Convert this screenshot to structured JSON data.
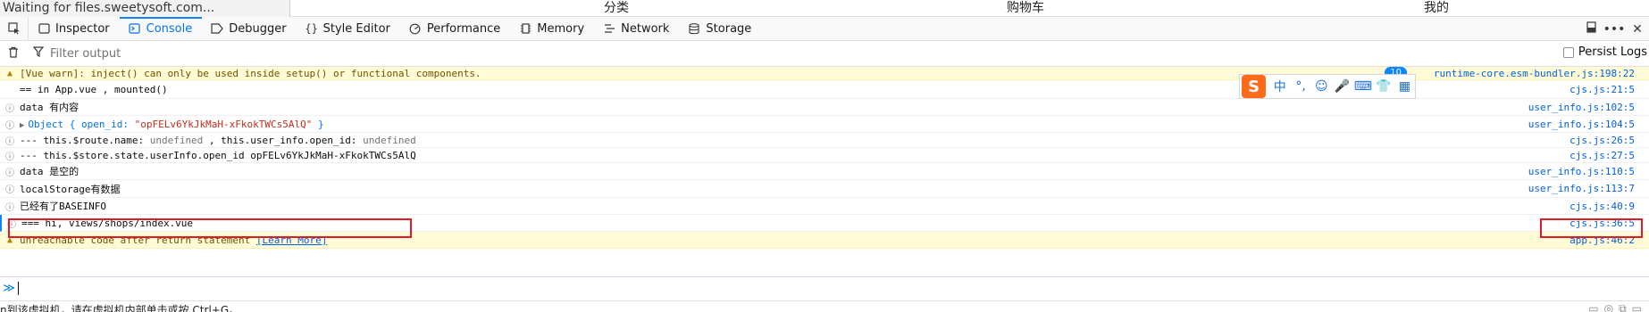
{
  "topbar": {
    "loading_text": "Waiting for files.sweetysoft.com...",
    "app_tabs": [
      "分类",
      "购物车",
      "我的"
    ]
  },
  "devtools": {
    "tabs": [
      {
        "label": "Inspector",
        "icon": "inspector-icon"
      },
      {
        "label": "Console",
        "icon": "console-icon",
        "active": true
      },
      {
        "label": "Debugger",
        "icon": "debugger-icon"
      },
      {
        "label": "Style Editor",
        "icon": "style-editor-icon"
      },
      {
        "label": "Performance",
        "icon": "performance-icon"
      },
      {
        "label": "Memory",
        "icon": "memory-icon"
      },
      {
        "label": "Network",
        "icon": "network-icon"
      },
      {
        "label": "Storage",
        "icon": "storage-icon"
      }
    ],
    "right_icons": [
      "dock-icon",
      "more-icon",
      "close-icon"
    ]
  },
  "filter": {
    "placeholder": "Filter output",
    "persist_label": "Persist Logs"
  },
  "console": {
    "messages": [
      {
        "level": "warn",
        "text": "[Vue warn]: inject() can only be used inside setup() or functional components.",
        "badge": "10",
        "source": "runtime-core.esm-bundler.js:198:22"
      },
      {
        "level": "log",
        "text": "== in App.vue , mounted()",
        "source": "cjs.js:21:5"
      },
      {
        "level": "info",
        "text": "data 有内容",
        "source": "user_info.js:102:5"
      },
      {
        "level": "info",
        "object_prefix": "Object { open_id: ",
        "object_value": "\"opFELv6YkJkMaH-xFkokTWCs5AlQ\"",
        "object_suffix": " }",
        "source": "user_info.js:104:5"
      },
      {
        "level": "info",
        "text_a": "--- this.$route.name: ",
        "undef_a": "undefined",
        "text_b": " , this.user_info.open_id: ",
        "undef_b": "undefined",
        "source": "cjs.js:26:5"
      },
      {
        "level": "info",
        "text": "--- this.$store.state.userInfo.open_id opFELv6YkJkMaH-xFkokTWCs5AlQ",
        "source": "cjs.js:27:5"
      },
      {
        "level": "info",
        "text": "data 是空的",
        "source": "user_info.js:110:5"
      },
      {
        "level": "info",
        "text": "localStorage有数据",
        "source": "user_info.js:113:7"
      },
      {
        "level": "info",
        "text": "已经有了BASEINFO",
        "source": "cjs.js:40:9"
      },
      {
        "level": "info",
        "text": "=== hi, views/shops/index.vue",
        "source": "cjs.js:36:5"
      },
      {
        "level": "warn",
        "text": "unreachable code after return statement ",
        "link": "[Learn More]",
        "source": "app.js:46:2"
      }
    ]
  },
  "ime": {
    "logo": "S",
    "items": [
      "中",
      "°,",
      "☺",
      "🎤",
      "⌨",
      "👕",
      "▦"
    ]
  },
  "vm_status": "n到该虚拟机，请在虚拟机内部单击或按 Ctrl+G。",
  "colors": {
    "accent": "#0a84ff",
    "warn_bg": "#fffbd6",
    "highlight_box": "#e01b24"
  }
}
